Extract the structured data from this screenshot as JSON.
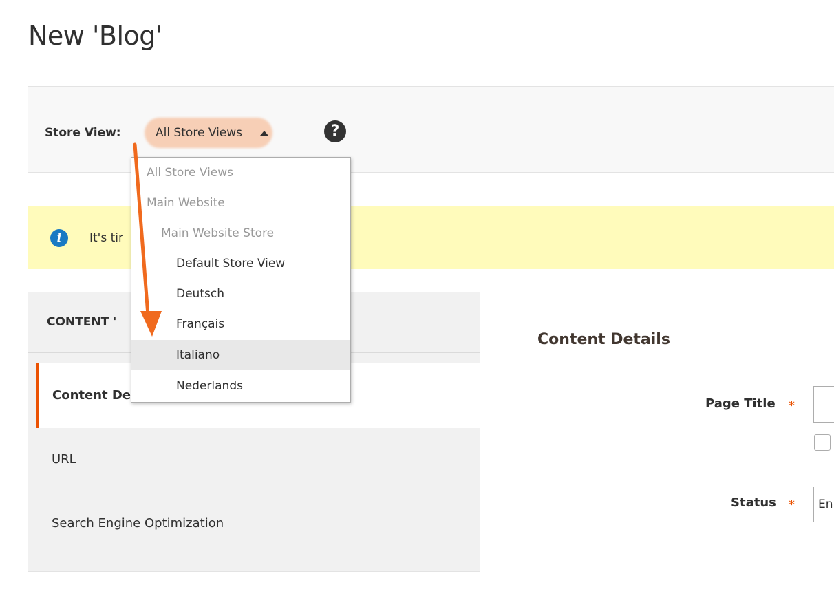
{
  "page": {
    "title": "New 'Blog'"
  },
  "store_view": {
    "label": "Store View:",
    "selected": "All Store Views",
    "help_glyph": "?",
    "options": [
      {
        "label": "All Store Views",
        "enabled": false
      },
      {
        "label": "Main Website",
        "enabled": false
      },
      {
        "label": "Main Website Store",
        "enabled": false
      },
      {
        "label": "Default Store View",
        "enabled": true
      },
      {
        "label": "Deutsch",
        "enabled": true
      },
      {
        "label": "Français",
        "enabled": true
      },
      {
        "label": "Italiano",
        "enabled": true,
        "hovered": true
      },
      {
        "label": "Nederlands",
        "enabled": true
      }
    ]
  },
  "notice": {
    "icon_glyph": "i",
    "text": "It's tir"
  },
  "sidebar": {
    "header": "CONTENT '",
    "items": [
      {
        "label": "Content De",
        "active": true
      },
      {
        "label": "URL",
        "active": false
      },
      {
        "label": "Search Engine Optimization",
        "active": false
      }
    ]
  },
  "content_details": {
    "title": "Content Details",
    "fields": {
      "page_title": {
        "label": "Page Title",
        "required_mark": "*",
        "value": ""
      },
      "status": {
        "label": "Status",
        "required_mark": "*",
        "value": "En"
      }
    }
  },
  "annotation": {
    "color": "#f06a1e",
    "highlight_color": "#f5965a"
  },
  "colors": {
    "accent": "#eb5202",
    "info": "#1979c3",
    "notice_bg": "#fffbbb"
  }
}
